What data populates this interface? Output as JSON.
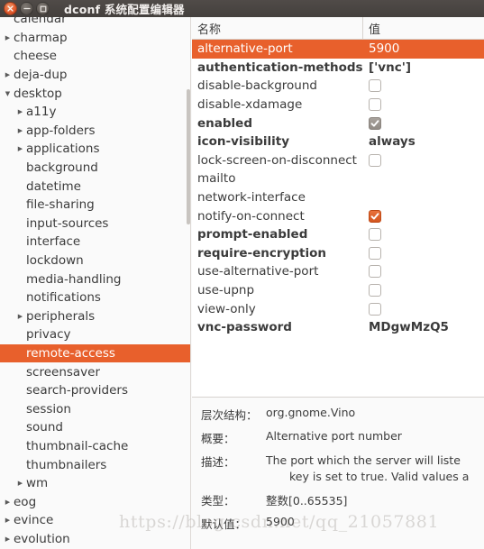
{
  "window": {
    "title": "dconf 系统配置编辑器",
    "controls": {
      "close": "close-button",
      "minimize": "minimize-button",
      "maximize": "maximize-button"
    }
  },
  "sidebar": {
    "items": [
      {
        "label": "calendar",
        "indent": 1,
        "expander": "none",
        "selected": false,
        "clipped": true
      },
      {
        "label": "charmap",
        "indent": 1,
        "expander": "collapsed",
        "selected": false
      },
      {
        "label": "cheese",
        "indent": 1,
        "expander": "none",
        "selected": false
      },
      {
        "label": "deja-dup",
        "indent": 1,
        "expander": "collapsed",
        "selected": false
      },
      {
        "label": "desktop",
        "indent": 1,
        "expander": "expanded",
        "selected": false
      },
      {
        "label": "a11y",
        "indent": 2,
        "expander": "collapsed",
        "selected": false
      },
      {
        "label": "app-folders",
        "indent": 2,
        "expander": "collapsed",
        "selected": false
      },
      {
        "label": "applications",
        "indent": 2,
        "expander": "collapsed",
        "selected": false
      },
      {
        "label": "background",
        "indent": 2,
        "expander": "none",
        "selected": false
      },
      {
        "label": "datetime",
        "indent": 2,
        "expander": "none",
        "selected": false
      },
      {
        "label": "file-sharing",
        "indent": 2,
        "expander": "none",
        "selected": false
      },
      {
        "label": "input-sources",
        "indent": 2,
        "expander": "none",
        "selected": false
      },
      {
        "label": "interface",
        "indent": 2,
        "expander": "none",
        "selected": false
      },
      {
        "label": "lockdown",
        "indent": 2,
        "expander": "none",
        "selected": false
      },
      {
        "label": "media-handling",
        "indent": 2,
        "expander": "none",
        "selected": false
      },
      {
        "label": "notifications",
        "indent": 2,
        "expander": "none",
        "selected": false
      },
      {
        "label": "peripherals",
        "indent": 2,
        "expander": "collapsed",
        "selected": false
      },
      {
        "label": "privacy",
        "indent": 2,
        "expander": "none",
        "selected": false
      },
      {
        "label": "remote-access",
        "indent": 2,
        "expander": "none",
        "selected": true
      },
      {
        "label": "screensaver",
        "indent": 2,
        "expander": "none",
        "selected": false
      },
      {
        "label": "search-providers",
        "indent": 2,
        "expander": "none",
        "selected": false
      },
      {
        "label": "session",
        "indent": 2,
        "expander": "none",
        "selected": false
      },
      {
        "label": "sound",
        "indent": 2,
        "expander": "none",
        "selected": false
      },
      {
        "label": "thumbnail-cache",
        "indent": 2,
        "expander": "none",
        "selected": false
      },
      {
        "label": "thumbnailers",
        "indent": 2,
        "expander": "none",
        "selected": false
      },
      {
        "label": "wm",
        "indent": 2,
        "expander": "collapsed",
        "selected": false
      },
      {
        "label": "eog",
        "indent": 1,
        "expander": "collapsed",
        "selected": false
      },
      {
        "label": "evince",
        "indent": 1,
        "expander": "collapsed",
        "selected": false
      },
      {
        "label": "evolution",
        "indent": 1,
        "expander": "collapsed",
        "selected": false
      }
    ]
  },
  "table": {
    "columns": {
      "name": "名称",
      "value": "值"
    },
    "rows": [
      {
        "name": "alternative-port",
        "value": "5900",
        "type": "text",
        "selected": true,
        "modified": false
      },
      {
        "name": "authentication-methods",
        "value": "['vnc']",
        "type": "text",
        "selected": false,
        "modified": true
      },
      {
        "name": "disable-background",
        "value": "",
        "type": "checkbox-empty",
        "selected": false,
        "modified": false
      },
      {
        "name": "disable-xdamage",
        "value": "",
        "type": "checkbox-empty",
        "selected": false,
        "modified": false
      },
      {
        "name": "enabled",
        "value": "",
        "type": "checkbox-gray",
        "selected": false,
        "modified": true
      },
      {
        "name": "icon-visibility",
        "value": "always",
        "type": "text",
        "selected": false,
        "modified": true
      },
      {
        "name": "lock-screen-on-disconnect",
        "value": "",
        "type": "checkbox-empty",
        "selected": false,
        "modified": false
      },
      {
        "name": "mailto",
        "value": "",
        "type": "none",
        "selected": false,
        "modified": false
      },
      {
        "name": "network-interface",
        "value": "",
        "type": "none",
        "selected": false,
        "modified": false
      },
      {
        "name": "notify-on-connect",
        "value": "",
        "type": "checkbox-orange",
        "selected": false,
        "modified": false
      },
      {
        "name": "prompt-enabled",
        "value": "",
        "type": "checkbox-empty",
        "selected": false,
        "modified": true
      },
      {
        "name": "require-encryption",
        "value": "",
        "type": "checkbox-empty",
        "selected": false,
        "modified": true
      },
      {
        "name": "use-alternative-port",
        "value": "",
        "type": "checkbox-empty",
        "selected": false,
        "modified": false
      },
      {
        "name": "use-upnp",
        "value": "",
        "type": "checkbox-empty",
        "selected": false,
        "modified": false
      },
      {
        "name": "view-only",
        "value": "",
        "type": "checkbox-empty",
        "selected": false,
        "modified": false
      },
      {
        "name": "vnc-password",
        "value": "MDgwMzQ5",
        "type": "text",
        "selected": false,
        "modified": true
      }
    ]
  },
  "detail": {
    "schema_label": "层次结构：",
    "schema_value": "org.gnome.Vino",
    "summary_label": "概要：",
    "summary_value": "Alternative port number",
    "description_label": "描述：",
    "description_line1": "The port which the server will liste",
    "description_line2": "key is set to true. Valid values a",
    "type_label": "类型：",
    "type_value": "整数[0..65535]",
    "default_label": "默认值：",
    "default_value": "5900"
  },
  "watermark": {
    "text": "https://blog.csdn.net/qq_21057881"
  },
  "colors": {
    "selection_orange": "#e8602c",
    "titlebar_dark": "#4a4541",
    "checkbox_orange": "#d4561f",
    "checkbox_gray": "#918b85"
  }
}
